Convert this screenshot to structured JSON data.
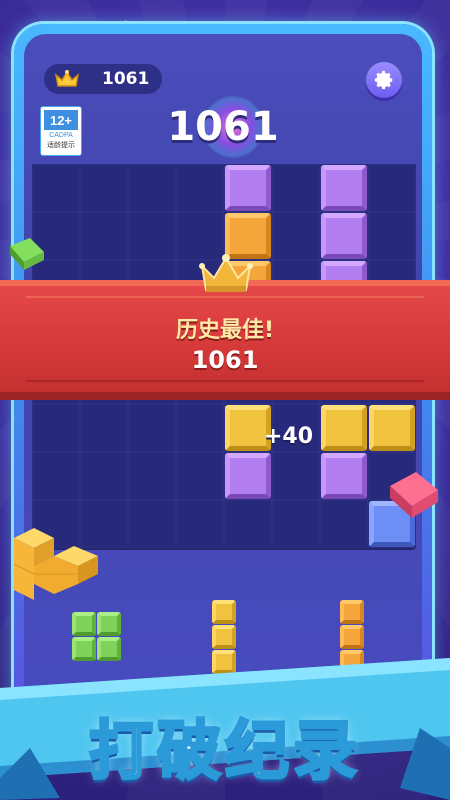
{
  "header": {
    "best_score": "1061",
    "current_score": "1061"
  },
  "age_rating": {
    "age": "12+",
    "org": "CADPA",
    "caption": "适龄提示"
  },
  "new_record_banner": {
    "title": "历史最佳!",
    "score": "1061"
  },
  "combo": {
    "points_text": "+40"
  },
  "promo": {
    "caption": "打破纪录"
  },
  "icons": {
    "crown": "crown-icon",
    "settings": "gear-icon"
  },
  "colors": {
    "banner": "#d73a3a",
    "board": "#24266e",
    "block_purple": "#b27ef0",
    "block_orange": "#f5a63a",
    "block_yellow": "#efc33d",
    "block_blue": "#6d8ef5",
    "block_green": "#7fd35a"
  }
}
